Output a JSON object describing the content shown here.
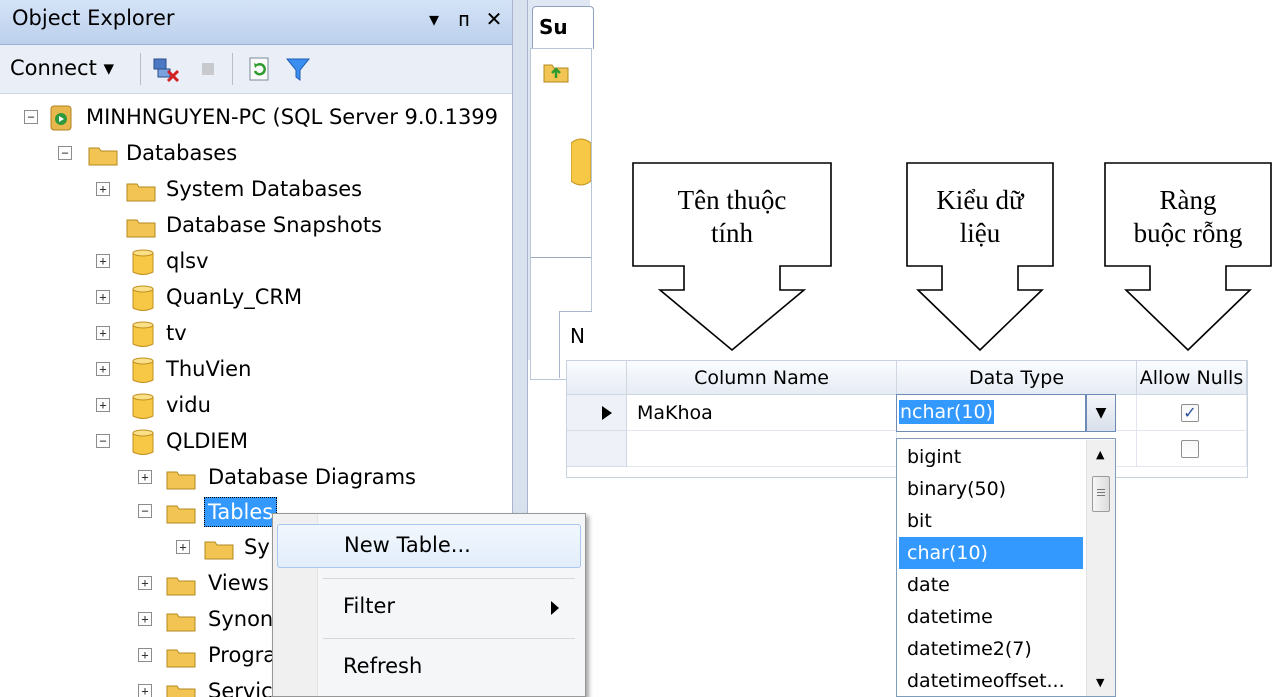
{
  "object_explorer": {
    "title": "Object Explorer",
    "title_buttons": [
      "▾",
      "ᴨ",
      "✕"
    ],
    "toolbar": {
      "connect_label": "Connect ▾"
    },
    "tree": {
      "server": "MINHNGUYEN-PC (SQL Server 9.0.1399",
      "databases": "Databases",
      "system_databases": "System Databases",
      "database_snapshots": "Database Snapshots",
      "db_qlsv": "qlsv",
      "db_quanly_crm": "QuanLy_CRM",
      "db_tv": "tv",
      "db_thuvien": "ThuVien",
      "db_vidu": "vidu",
      "db_qldiem": "QLDIEM",
      "database_diagrams": "Database Diagrams",
      "tables": "Tables",
      "system_tables": "Sy",
      "views": "Views",
      "synonyms": "Synon",
      "programmability": "Progra",
      "service_broker": "Servic"
    }
  },
  "context_menu": {
    "new_table": "New Table...",
    "filter": "Filter",
    "refresh": "Refresh"
  },
  "right_pane": {
    "tab_label": "Su",
    "column_head": "N"
  },
  "callouts": {
    "name": [
      "Tên thuộc",
      "tính"
    ],
    "type": [
      "Kiểu dữ",
      "liệu"
    ],
    "nulls": [
      "Ràng",
      "buộc rỗng"
    ]
  },
  "grid": {
    "headers": {
      "column_name": "Column Name",
      "data_type": "Data Type",
      "allow_nulls": "Allow Nulls"
    },
    "row1": {
      "column_name": "MaKhoa",
      "data_type": "nchar(10)",
      "allow_nulls_checked": true
    },
    "row2": {
      "allow_nulls_checked": false
    }
  },
  "dropdown": {
    "options": [
      "bigint",
      "binary(50)",
      "bit",
      "char(10)",
      "date",
      "datetime",
      "datetime2(7)",
      "datetimeoffset..."
    ],
    "selected": "char(10)"
  },
  "colors": {
    "selection": "#3399ff",
    "folder": "#f2c453",
    "database": "#f6c845"
  }
}
